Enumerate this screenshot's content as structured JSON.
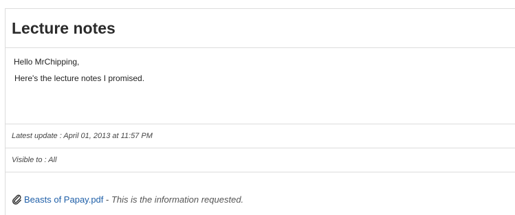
{
  "post": {
    "title": "Lecture notes",
    "greeting": "Hello MrChipping,",
    "message": "Here's the lecture notes I promised.",
    "latest_update": "Latest update : April 01, 2013 at 11:57 PM",
    "visible_to": "Visible to :  All"
  },
  "attachment": {
    "icon": "paperclip-icon",
    "filename": "Beasts of Papay.pdf",
    "separator": " - ",
    "description": "This is the information requested."
  },
  "colors": {
    "link": "#1f5fa8",
    "border": "#dcdcdc"
  }
}
